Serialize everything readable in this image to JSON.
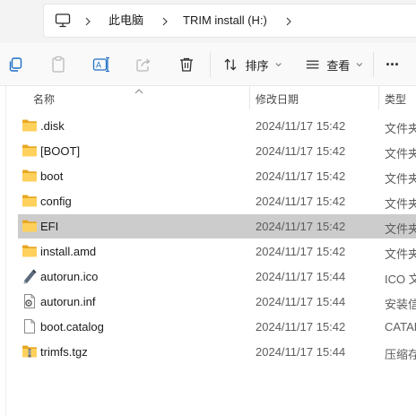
{
  "breadcrumb": {
    "items": [
      {
        "label": "此电脑"
      },
      {
        "label": "TRIM install (H:)"
      }
    ]
  },
  "toolbar": {
    "sort_label": "排序",
    "view_label": "查看",
    "more_label": "···"
  },
  "columns": {
    "name": "名称",
    "date": "修改日期",
    "type": "类型"
  },
  "files": [
    {
      "name": ".disk",
      "date": "2024/11/17 15:42",
      "type": "文件夹",
      "icon": "folder-icon"
    },
    {
      "name": "[BOOT]",
      "date": "2024/11/17 15:42",
      "type": "文件夹",
      "icon": "folder-icon"
    },
    {
      "name": "boot",
      "date": "2024/11/17 15:42",
      "type": "文件夹",
      "icon": "folder-icon"
    },
    {
      "name": "config",
      "date": "2024/11/17 15:42",
      "type": "文件夹",
      "icon": "folder-icon"
    },
    {
      "name": "EFI",
      "date": "2024/11/17 15:42",
      "type": "文件夹",
      "icon": "folder-icon",
      "selected": true
    },
    {
      "name": "install.amd",
      "date": "2024/11/17 15:42",
      "type": "文件夹",
      "icon": "folder-icon"
    },
    {
      "name": "autorun.ico",
      "date": "2024/11/17 15:44",
      "type": "ICO 文",
      "icon": "ico-file-icon"
    },
    {
      "name": "autorun.inf",
      "date": "2024/11/17 15:44",
      "type": "安装信",
      "icon": "inf-file-icon"
    },
    {
      "name": "boot.catalog",
      "date": "2024/11/17 15:42",
      "type": "CATAL",
      "icon": "file-icon"
    },
    {
      "name": "trimfs.tgz",
      "date": "2024/11/17 15:44",
      "type": "压缩存",
      "icon": "archive-icon"
    }
  ]
}
